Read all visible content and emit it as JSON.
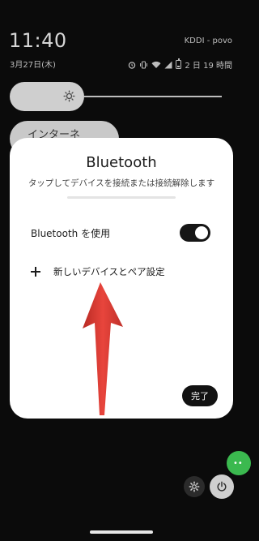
{
  "status_bar": {
    "time": "11:40",
    "date": "3月27日(木)",
    "carrier": "KDDI - povo",
    "battery_text": "2 日 19 時間",
    "icons": [
      "alarm-icon",
      "vibrate-icon",
      "wifi-icon",
      "signal-icon",
      "battery-icon"
    ]
  },
  "quick_settings": {
    "brightness_level": 0.35,
    "tile_label_partial": "インターネ"
  },
  "dialog": {
    "title": "Bluetooth",
    "subtitle": "タップしてデバイスを接続または接続解除します",
    "toggle_label": "Bluetooth を使用",
    "toggle_on": true,
    "pair_label": "新しいデバイスとペア設定",
    "done_label": "完了"
  },
  "annotation": {
    "arrow_color": "#d93a32"
  },
  "colors": {
    "background": "#0b0b0b",
    "dialog": "#ffffff",
    "toggle_on": "#161616",
    "fab": "#3bb94f"
  }
}
